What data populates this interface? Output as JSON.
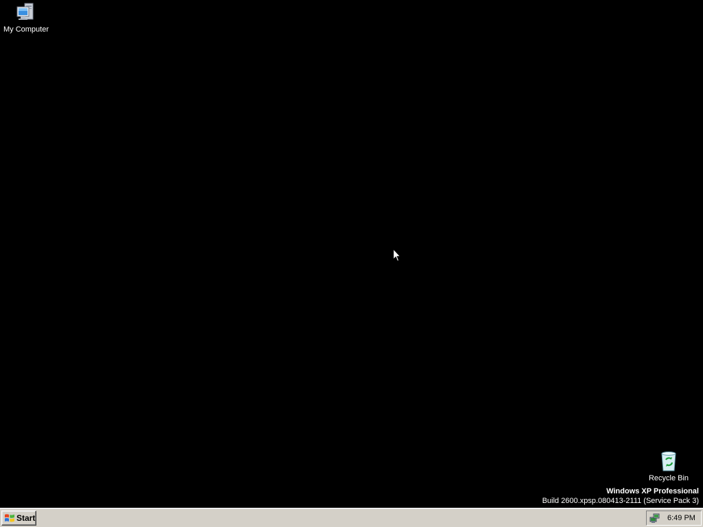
{
  "desktop": {
    "background_color": "#000000",
    "icons": [
      {
        "label": "My Computer",
        "icon": "my-computer-icon"
      },
      {
        "label": "Recycle Bin",
        "icon": "recycle-bin-icon"
      }
    ]
  },
  "watermark": {
    "product": "Windows XP Professional",
    "build": "Build 2600.xpsp.080413-2111 (Service Pack 3)"
  },
  "taskbar": {
    "background_color": "#d4d0c8",
    "start_label": "Start",
    "start_icon": "windows-logo-icon",
    "tray_icon": "network-connection-icon",
    "clock": "6:49 PM"
  },
  "cursor": {
    "icon": "arrow-cursor-icon"
  }
}
